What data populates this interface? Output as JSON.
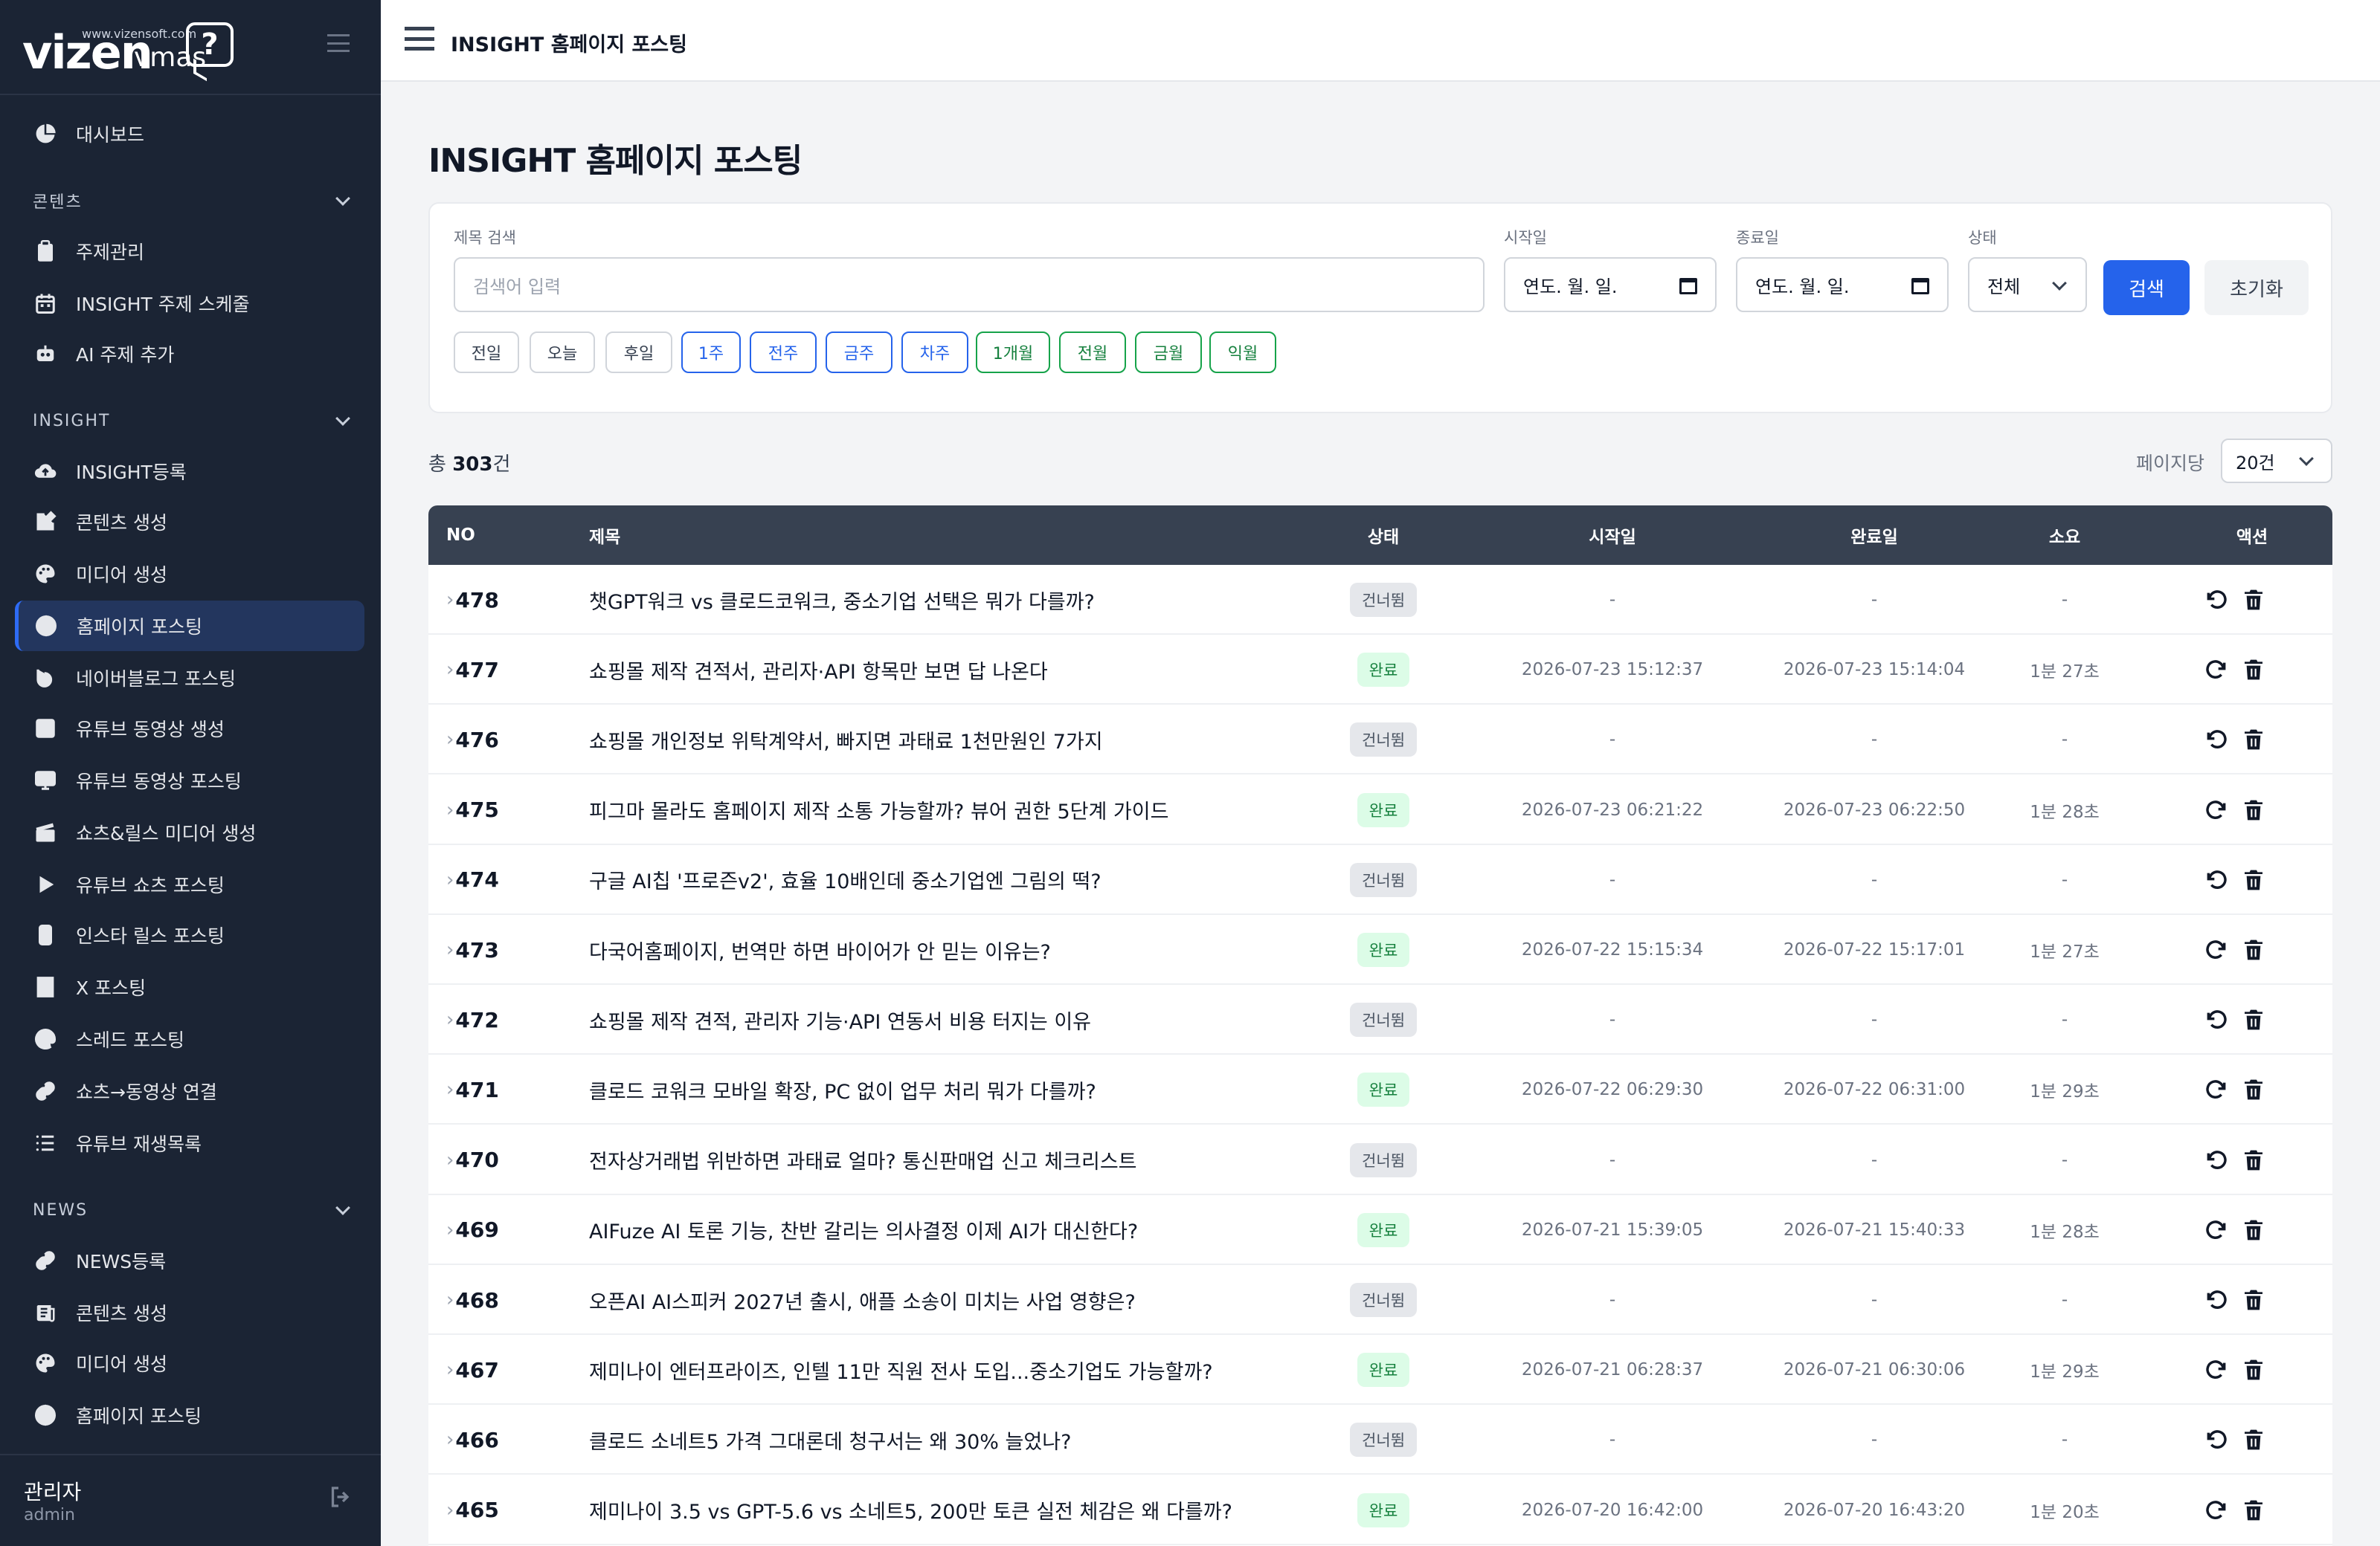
{
  "logo": {
    "url": "www.vizensoft.com",
    "brand": "vizen",
    "product": "vmas",
    "mark": "?"
  },
  "sidebar": {
    "items": [
      {
        "label": "대시보드",
        "icon": "pie-chart-icon"
      },
      {
        "label": "주제관리",
        "icon": "clipboard-icon"
      },
      {
        "label": "INSIGHT 주제 스케줄",
        "icon": "calendar-icon"
      },
      {
        "label": "AI 주제 추가",
        "icon": "robot-icon"
      },
      {
        "label": "INSIGHT등록",
        "icon": "cloud-upload-icon"
      },
      {
        "label": "콘텐츠 생성",
        "icon": "edit-icon"
      },
      {
        "label": "미디어 생성",
        "icon": "palette-icon"
      },
      {
        "label": "홈페이지 포스팅",
        "icon": "globe-icon"
      },
      {
        "label": "네이버블로그 포스팅",
        "icon": "blog-icon"
      },
      {
        "label": "유튜브 동영상 생성",
        "icon": "film-icon"
      },
      {
        "label": "유튜브 동영상 포스팅",
        "icon": "monitor-icon"
      },
      {
        "label": "쇼츠&릴스 미디어 생성",
        "icon": "clapper-icon"
      },
      {
        "label": "유튜브 쇼츠 포스팅",
        "icon": "play-icon"
      },
      {
        "label": "인스타 릴스 포스팅",
        "icon": "phone-icon"
      },
      {
        "label": "X 포스팅",
        "icon": "x-icon"
      },
      {
        "label": "스레드 포스팅",
        "icon": "at-icon"
      },
      {
        "label": "쇼츠→동영상 연결",
        "icon": "link-icon"
      },
      {
        "label": "유튜브 재생목록",
        "icon": "list-icon"
      },
      {
        "label": "NEWS등록",
        "icon": "link-icon"
      },
      {
        "label": "콘텐츠 생성",
        "icon": "newspaper-icon"
      },
      {
        "label": "미디어 생성",
        "icon": "palette-icon"
      },
      {
        "label": "홈페이지 포스팅",
        "icon": "globe-icon"
      }
    ],
    "sections": [
      "콘텐츠",
      "INSIGHT",
      "NEWS"
    ],
    "active_index": 7
  },
  "user": {
    "name": "관리자",
    "role": "admin"
  },
  "topbar": {
    "title": "INSIGHT 홈페이지 포스팅"
  },
  "page": {
    "title": "INSIGHT 홈페이지 포스팅"
  },
  "filters": {
    "title_label": "제목 검색",
    "title_placeholder": "검색어 입력",
    "start_label": "시작일",
    "start_value": "연도. 월. 일.",
    "end_label": "종료일",
    "end_value": "연도. 월. 일.",
    "status_label": "상태",
    "status_value": "전체",
    "search_button": "검색",
    "reset_button": "초기화",
    "quick_ranges": [
      "전일",
      "오늘",
      "후일",
      "1주",
      "전주",
      "금주",
      "차주",
      "1개월",
      "전월",
      "금월",
      "익월"
    ]
  },
  "summary": {
    "prefix": "총 ",
    "count": "303",
    "suffix": "건",
    "per_page_label": "페이지당",
    "per_page_value": "20건"
  },
  "table": {
    "headers": [
      "NO",
      "제목",
      "상태",
      "시작일",
      "완료일",
      "소요",
      "액션"
    ],
    "rows": [
      {
        "no": "478",
        "title": "챗GPT워크 vs 클로드코워크, 중소기업 선택은 뭐가 다를까?",
        "status": "건너뜀",
        "start": "-",
        "end": "-",
        "duration": "-"
      },
      {
        "no": "477",
        "title": "쇼핑몰 제작 견적서, 관리자·API 항목만 보면 답 나온다",
        "status": "완료",
        "start": "2026-07-23 15:12:37",
        "end": "2026-07-23 15:14:04",
        "duration": "1분 27초"
      },
      {
        "no": "476",
        "title": "쇼핑몰 개인정보 위탁계약서, 빠지면 과태료 1천만원인 7가지",
        "status": "건너뜀",
        "start": "-",
        "end": "-",
        "duration": "-"
      },
      {
        "no": "475",
        "title": "피그마 몰라도 홈페이지 제작 소통 가능할까? 뷰어 권한 5단계 가이드",
        "status": "완료",
        "start": "2026-07-23 06:21:22",
        "end": "2026-07-23 06:22:50",
        "duration": "1분 28초"
      },
      {
        "no": "474",
        "title": "구글 AI칩 '프로즌v2', 효율 10배인데 중소기업엔 그림의 떡?",
        "status": "건너뜀",
        "start": "-",
        "end": "-",
        "duration": "-"
      },
      {
        "no": "473",
        "title": "다국어홈페이지, 번역만 하면 바이어가 안 믿는 이유는?",
        "status": "완료",
        "start": "2026-07-22 15:15:34",
        "end": "2026-07-22 15:17:01",
        "duration": "1분 27초"
      },
      {
        "no": "472",
        "title": "쇼핑몰 제작 견적, 관리자 기능·API 연동서 비용 터지는 이유",
        "status": "건너뜀",
        "start": "-",
        "end": "-",
        "duration": "-"
      },
      {
        "no": "471",
        "title": "클로드 코워크 모바일 확장, PC 없이 업무 처리 뭐가 다를까?",
        "status": "완료",
        "start": "2026-07-22 06:29:30",
        "end": "2026-07-22 06:31:00",
        "duration": "1분 29초"
      },
      {
        "no": "470",
        "title": "전자상거래법 위반하면 과태료 얼마? 통신판매업 신고 체크리스트",
        "status": "건너뜀",
        "start": "-",
        "end": "-",
        "duration": "-"
      },
      {
        "no": "469",
        "title": "AIFuze AI 토론 기능, 찬반 갈리는 의사결정 이제 AI가 대신한다?",
        "status": "완료",
        "start": "2026-07-21 15:39:05",
        "end": "2026-07-21 15:40:33",
        "duration": "1분 28초"
      },
      {
        "no": "468",
        "title": "오픈AI AI스피커 2027년 출시, 애플 소송이 미치는 사업 영향은?",
        "status": "건너뜀",
        "start": "-",
        "end": "-",
        "duration": "-"
      },
      {
        "no": "467",
        "title": "제미나이 엔터프라이즈, 인텔 11만 직원 전사 도입...중소기업도 가능할까?",
        "status": "완료",
        "start": "2026-07-21 06:28:37",
        "end": "2026-07-21 06:30:06",
        "duration": "1분 29초"
      },
      {
        "no": "466",
        "title": "클로드 소네트5 가격 그대론데 청구서는 왜 30% 늘었나?",
        "status": "건너뜀",
        "start": "-",
        "end": "-",
        "duration": "-"
      },
      {
        "no": "465",
        "title": "제미나이 3.5 vs GPT-5.6 vs 소네트5, 200만 토큰 실전 체감은 왜 다를까?",
        "status": "완료",
        "start": "2026-07-20 16:42:00",
        "end": "2026-07-20 16:43:20",
        "duration": "1분 20초"
      }
    ]
  },
  "colors": {
    "sidebar": "#1b2434",
    "accent": "#2563eb",
    "done": "#15803d",
    "header": "#374151"
  }
}
